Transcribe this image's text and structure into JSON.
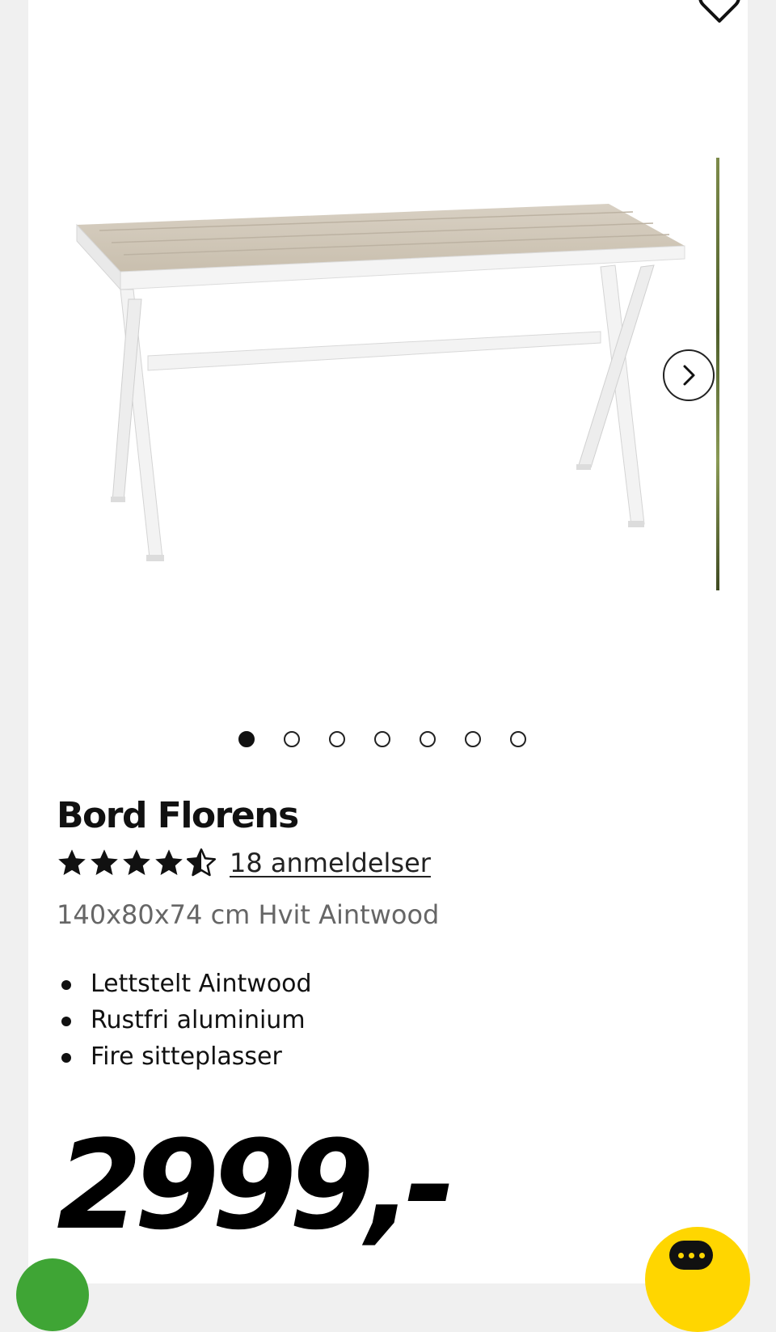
{
  "product": {
    "name": "Bord Florens",
    "rating": 4.5,
    "rating_max": 5,
    "reviews_text": "18 anmeldelser",
    "variant": "140x80x74 cm Hvit Aintwood",
    "features": [
      "Lettstelt Aintwood",
      "Rustfri aluminium",
      "Fire sitteplasser"
    ],
    "price": "2999,-"
  },
  "gallery": {
    "image_count": 7,
    "active_index": 0
  },
  "icons": {
    "favorite": "heart-icon",
    "next": "chevron-right-icon",
    "chat": "chat-bubble-icon",
    "rating": "star-icon"
  },
  "colors": {
    "chat_button": "#ffd600",
    "text": "#111111",
    "muted_text": "#666666",
    "page_background": "#f0f0f0"
  }
}
